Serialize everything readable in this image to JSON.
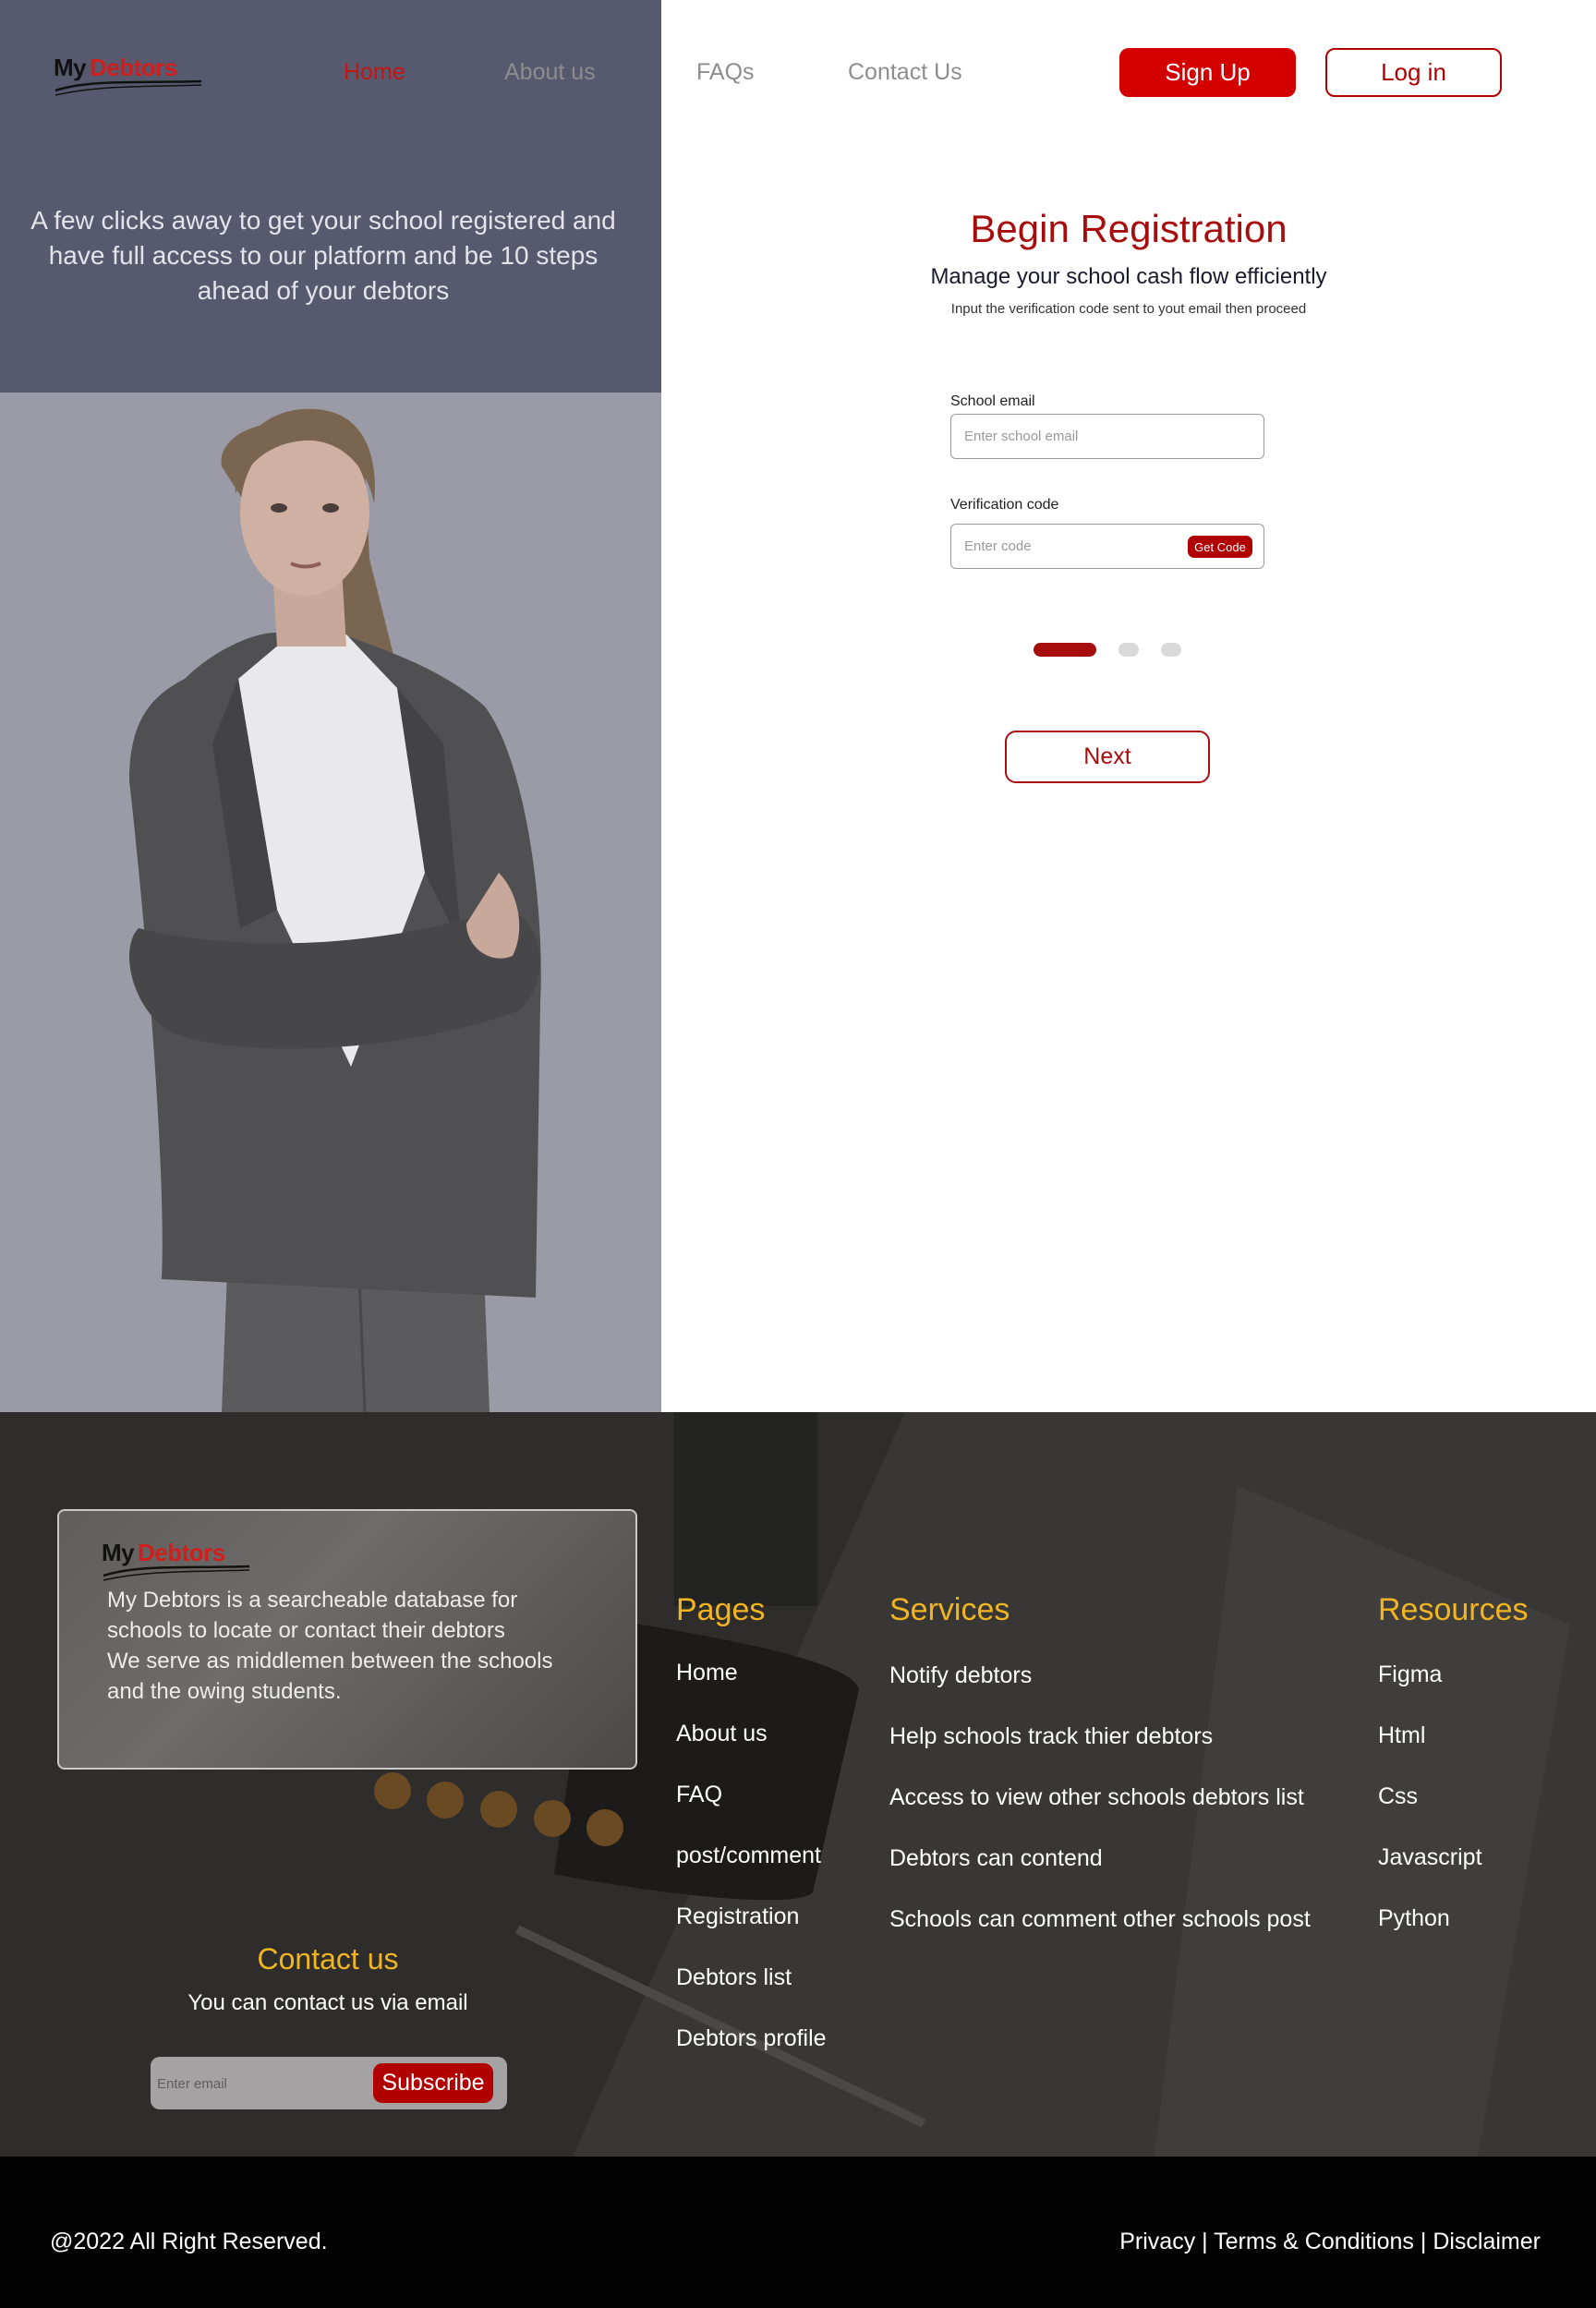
{
  "header": {
    "logo": {
      "part1": "My",
      "part2": "Debtors"
    },
    "nav": [
      "Home",
      "About us",
      "FAQs",
      "Contact Us"
    ],
    "signup_label": "Sign Up",
    "login_label": "Log in"
  },
  "hero": {
    "text": "A few clicks away to get your school registered and have full access to our platform and be 10 steps ahead of your debtors"
  },
  "registration": {
    "title": "Begin Registration",
    "subtitle": "Manage  your school cash flow efficiently",
    "hint": "Input the verification code sent to yout email then proceed",
    "email_label": "School email",
    "email_placeholder": "Enter school email",
    "code_label": "Verification code",
    "code_placeholder": "Enter code",
    "get_code_label": "Get Code",
    "progress": {
      "current_step": 1,
      "total_steps": 3
    },
    "next_label": "Next"
  },
  "footer": {
    "about_lines": [
      "My Debtors is a searcheable database for",
      "schools to locate or contact their debtors",
      "We serve as middlemen between the schools",
      "and the owing students."
    ],
    "pages": {
      "heading": "Pages",
      "items": [
        "Home",
        "About us",
        "FAQ",
        "post/comment",
        "Registration",
        "Debtors list",
        "Debtors profile"
      ]
    },
    "services": {
      "heading": "Services",
      "items": [
        "Notify debtors",
        "Help schools track thier debtors",
        "Access to view other schools debtors list",
        "Debtors can contend",
        "Schools can comment other schools post"
      ]
    },
    "resources": {
      "heading": "Resources",
      "items": [
        "Figma",
        "Html",
        "Css",
        "Javascript",
        "Python"
      ]
    },
    "contact": {
      "heading": "Contact us",
      "subtext": "You can contact us via email",
      "email_placeholder": "Enter email",
      "subscribe_label": "Subscribe"
    }
  },
  "bottom_bar": {
    "copyright": "@2022 All Right Reserved.",
    "links": [
      "Privacy",
      "Terms & Conditions",
      "Disclaimer"
    ]
  },
  "colors": {
    "brand_red": "#d40000",
    "dark_red": "#a80d0d",
    "accent_yellow": "#f2b522",
    "hero_panel": "#575a6e",
    "footer_bg": "#2e2d2c"
  }
}
